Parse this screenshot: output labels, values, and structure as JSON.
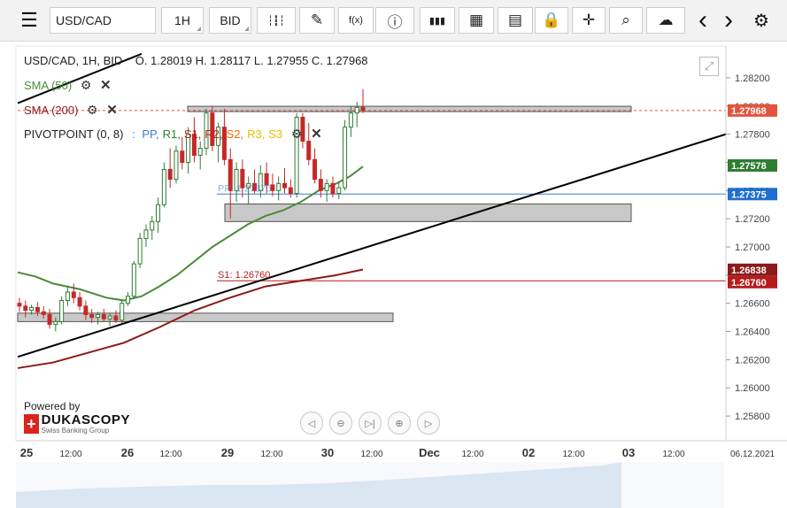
{
  "toolbar": {
    "symbol": "USD/CAD",
    "timeframe": "1H",
    "price_side": "BID",
    "buttons": [
      {
        "name": "candle-type-icon",
        "glyph": "┆┇┆"
      },
      {
        "name": "draw-pen-icon",
        "glyph": "✎"
      },
      {
        "name": "function-icon",
        "glyph": "f(x)"
      },
      {
        "name": "info-icon",
        "glyph": "ⓘ"
      },
      {
        "name": "volume-bars-icon",
        "glyph": "▮▮▮"
      },
      {
        "name": "calendar-icon",
        "glyph": "▦"
      },
      {
        "name": "news-icon",
        "glyph": "▤"
      },
      {
        "name": "lock-icon",
        "glyph": "🔒"
      },
      {
        "name": "crosshair-icon",
        "glyph": "✛"
      },
      {
        "name": "zoom-icon",
        "glyph": "⌕"
      },
      {
        "name": "cloud-upload-icon",
        "glyph": "☁"
      }
    ],
    "nav_prev": "‹",
    "nav_next": "›",
    "settings": "⚙",
    "menu": "☰"
  },
  "legend": {
    "ohlc": "USD/CAD, 1H, BID    O. 1.28019 H. 1.28117 L. 1.27955 C. 1.27968",
    "sma50": "SMA (50)",
    "sma200": "SMA (200)",
    "pivot_label": "PIVOTPOINT (0, 8)",
    "pivot_items": [
      {
        "text": "PP",
        "color": "#3a7bd5"
      },
      {
        "text": "R1",
        "color": "#2e7d32"
      },
      {
        "text": "S1",
        "color": "#b71c1c"
      },
      {
        "text": "R2",
        "color": "#c62828"
      },
      {
        "text": "S2",
        "color": "#ef6c00"
      },
      {
        "text": "R3",
        "color": "#e6c200"
      },
      {
        "text": "S3",
        "color": "#e6c200"
      }
    ]
  },
  "watermark": {
    "powered": "Powered by",
    "brand": "DUKASCOPY",
    "sub": "Swiss Banking Group"
  },
  "colors": {
    "up": "#2e7d32",
    "down": "#c62828",
    "sma50": "#4a8a3a",
    "sma200": "#8b1a1a",
    "trendline": "#000000",
    "zone": "#c8c8c8",
    "pp_line": "#3a7bd5",
    "s1_line": "#b71c1c"
  },
  "chart_data": {
    "type": "candlestick",
    "ylim": [
      1.257,
      1.283
    ],
    "y_ticks": [
      "1.28200",
      "1.28000",
      "1.27800",
      "1.27600",
      "1.27400",
      "1.27200",
      "1.27000",
      "1.26800",
      "1.26600",
      "1.26400",
      "1.26200",
      "1.26000",
      "1.25800"
    ],
    "x_ticks": [
      "25",
      "12:00",
      "26",
      "12:00",
      "29",
      "12:00",
      "30",
      "12:00",
      "Dec",
      "12:00",
      "02",
      "12:00",
      "03",
      "12:00",
      "06.12.2021"
    ],
    "price_tags": [
      {
        "value": "1.27968",
        "color": "#e5533d"
      },
      {
        "value": "1.27578",
        "color": "#2e7d32"
      },
      {
        "value": "1.27375",
        "color": "#1f6fd1"
      },
      {
        "value": "1.26838",
        "color": "#8b1a1a"
      },
      {
        "value": "1.26760",
        "color": "#b71c1c"
      }
    ],
    "s1_label": "S1: 1.26760",
    "pp_label": "PP: 1.27375",
    "candles": [
      [
        1.266,
        1.2664,
        1.2654,
        1.2658
      ],
      [
        1.2658,
        1.2662,
        1.265,
        1.2655
      ],
      [
        1.2655,
        1.2659,
        1.2652,
        1.2657
      ],
      [
        1.2657,
        1.2661,
        1.2651,
        1.2654
      ],
      [
        1.2654,
        1.2658,
        1.2649,
        1.2652
      ],
      [
        1.2652,
        1.2656,
        1.2642,
        1.2645
      ],
      [
        1.2645,
        1.265,
        1.264,
        1.2647
      ],
      [
        1.2647,
        1.2665,
        1.2645,
        1.2662
      ],
      [
        1.2662,
        1.2672,
        1.2658,
        1.2668
      ],
      [
        1.2668,
        1.2674,
        1.266,
        1.2664
      ],
      [
        1.2664,
        1.2668,
        1.2655,
        1.2658
      ],
      [
        1.2658,
        1.2662,
        1.2648,
        1.2652
      ],
      [
        1.2652,
        1.2656,
        1.2646,
        1.265
      ],
      [
        1.265,
        1.2654,
        1.2645,
        1.2652
      ],
      [
        1.2652,
        1.2656,
        1.2647,
        1.2649
      ],
      [
        1.2649,
        1.2653,
        1.2644,
        1.2651
      ],
      [
        1.2651,
        1.2655,
        1.2646,
        1.2648
      ],
      [
        1.2648,
        1.2662,
        1.2646,
        1.266
      ],
      [
        1.266,
        1.2668,
        1.2658,
        1.2665
      ],
      [
        1.2665,
        1.269,
        1.2663,
        1.2688
      ],
      [
        1.2688,
        1.271,
        1.2685,
        1.2706
      ],
      [
        1.2706,
        1.2716,
        1.27,
        1.2712
      ],
      [
        1.2712,
        1.2722,
        1.2705,
        1.2718
      ],
      [
        1.2718,
        1.2735,
        1.271,
        1.273
      ],
      [
        1.273,
        1.276,
        1.2728,
        1.2755
      ],
      [
        1.2755,
        1.277,
        1.2742,
        1.2748
      ],
      [
        1.2748,
        1.2772,
        1.2745,
        1.2768
      ],
      [
        1.2768,
        1.2778,
        1.2755,
        1.276
      ],
      [
        1.276,
        1.2785,
        1.2752,
        1.278
      ],
      [
        1.278,
        1.2792,
        1.276,
        1.2765
      ],
      [
        1.2765,
        1.2775,
        1.2755,
        1.277
      ],
      [
        1.277,
        1.2798,
        1.2765,
        1.2795
      ],
      [
        1.2795,
        1.28,
        1.2768,
        1.2772
      ],
      [
        1.2772,
        1.2788,
        1.276,
        1.2785
      ],
      [
        1.2785,
        1.2798,
        1.2758,
        1.2762
      ],
      [
        1.2762,
        1.277,
        1.272,
        1.274
      ],
      [
        1.274,
        1.276,
        1.2732,
        1.2755
      ],
      [
        1.2755,
        1.2762,
        1.2735,
        1.2742
      ],
      [
        1.2742,
        1.275,
        1.273,
        1.2745
      ],
      [
        1.2745,
        1.2755,
        1.2738,
        1.274
      ],
      [
        1.274,
        1.2758,
        1.2735,
        1.2752
      ],
      [
        1.2752,
        1.276,
        1.2738,
        1.2744
      ],
      [
        1.2744,
        1.2752,
        1.2736,
        1.274
      ],
      [
        1.274,
        1.275,
        1.2733,
        1.2745
      ],
      [
        1.2745,
        1.2756,
        1.2738,
        1.2742
      ],
      [
        1.2742,
        1.2748,
        1.2735,
        1.2738
      ],
      [
        1.2738,
        1.2795,
        1.2735,
        1.2792
      ],
      [
        1.2792,
        1.2795,
        1.277,
        1.2775
      ],
      [
        1.2775,
        1.2788,
        1.2758,
        1.2762
      ],
      [
        1.2762,
        1.277,
        1.2745,
        1.2748
      ],
      [
        1.2748,
        1.2755,
        1.2735,
        1.274
      ],
      [
        1.274,
        1.2748,
        1.2732,
        1.2745
      ],
      [
        1.2745,
        1.275,
        1.2735,
        1.2738
      ],
      [
        1.2738,
        1.2746,
        1.2734,
        1.2742
      ],
      [
        1.2742,
        1.279,
        1.274,
        1.2785
      ],
      [
        1.2785,
        1.28,
        1.2778,
        1.2795
      ],
      [
        1.2795,
        1.2803,
        1.2785,
        1.2799
      ],
      [
        1.2799,
        1.2812,
        1.2795,
        1.2797
      ]
    ],
    "sma50": [
      [
        20,
        1.2682
      ],
      [
        40,
        1.2679
      ],
      [
        60,
        1.2674
      ],
      [
        90,
        1.267
      ],
      [
        120,
        1.2664
      ],
      [
        140,
        1.2662
      ],
      [
        160,
        1.2665
      ],
      [
        180,
        1.2672
      ],
      [
        200,
        1.268
      ],
      [
        220,
        1.269
      ],
      [
        240,
        1.27
      ],
      [
        260,
        1.2708
      ],
      [
        280,
        1.2716
      ],
      [
        300,
        1.2722
      ],
      [
        320,
        1.2726
      ],
      [
        340,
        1.2732
      ],
      [
        360,
        1.274
      ],
      [
        380,
        1.2745
      ],
      [
        395,
        1.275
      ],
      [
        410,
        1.2757
      ]
    ],
    "sma200": [
      [
        20,
        1.2614
      ],
      [
        60,
        1.2618
      ],
      [
        100,
        1.2625
      ],
      [
        140,
        1.2632
      ],
      [
        180,
        1.2643
      ],
      [
        220,
        1.2655
      ],
      [
        260,
        1.2664
      ],
      [
        300,
        1.2672
      ],
      [
        340,
        1.2676
      ],
      [
        380,
        1.268
      ],
      [
        410,
        1.2684
      ]
    ],
    "trendlines": [
      {
        "x1": 20,
        "y1": 1.2622,
        "x2": 820,
        "y2": 1.278
      },
      {
        "x1": 20,
        "y1": 1.2802,
        "x2": 160,
        "y2": 1.2837
      }
    ],
    "zones": [
      {
        "x1": 212,
        "x2": 713,
        "y_top": 1.27998,
        "y_bot": 1.27984
      },
      {
        "x1": 254,
        "x2": 713,
        "y_top": 1.27305,
        "y_bot": 1.2718
      },
      {
        "x1": 20,
        "x2": 444,
        "y_top": 1.2653,
        "y_bot": 1.2647
      }
    ]
  }
}
